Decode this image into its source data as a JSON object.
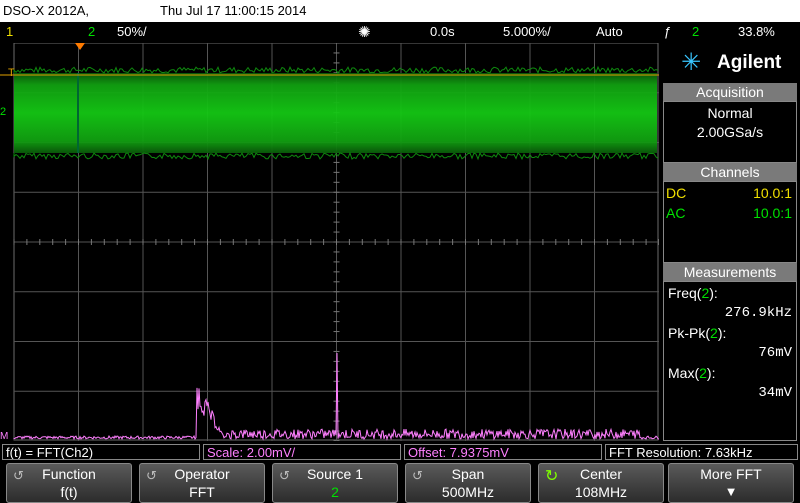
{
  "titlebar": {
    "model": "DSO-X 2012A,",
    "datetime": "Thu Jul 17 11:00:15 2014"
  },
  "statusbar": {
    "ch1_label": "1",
    "ch2_label": "2",
    "ch2_scale": "50%/",
    "trigger_pos": "0.0s",
    "timebase": "5.000%/",
    "trigger_mode": "Auto",
    "trigger_src": "2",
    "trigger_level": "33.8%",
    "colors": {
      "ch1": "#f0e000",
      "ch2": "#00e000",
      "math": "#ff80ff"
    }
  },
  "brand": {
    "name": "Agilent"
  },
  "acquisition": {
    "header": "Acquisition",
    "mode": "Normal",
    "rate": "2.00GSa/s"
  },
  "channels": {
    "header": "Channels",
    "rows": [
      {
        "coupling": "DC",
        "probe": "10.0:1"
      },
      {
        "coupling": "AC",
        "probe": "10.0:1"
      }
    ]
  },
  "measurements": {
    "header": "Measurements",
    "items": [
      {
        "name": "Freq",
        "src": "2",
        "value": "276.9kHz"
      },
      {
        "name": "Pk-Pk",
        "src": "2",
        "value": "76mV"
      },
      {
        "name": "Max",
        "src": "2",
        "value": "34mV"
      }
    ]
  },
  "grid_markers": {
    "trigger_mark": "T",
    "ch2_mark": "2",
    "math_mark": "M"
  },
  "infobar": {
    "function": "f(t) = FFT(Ch2)",
    "scale": "Scale: 2.00mV/",
    "offset": "Offset: 7.9375mV",
    "resolution": "FFT Resolution: 7.63kHz"
  },
  "softkeys": [
    {
      "label": "Function",
      "value": "f(t)"
    },
    {
      "label": "Operator",
      "value": "FFT"
    },
    {
      "label": "Source 1",
      "value": "2"
    },
    {
      "label": "Span",
      "value": "500MHz"
    },
    {
      "label": "Center",
      "value": "108MHz"
    },
    {
      "label": "More FFT",
      "value": ""
    }
  ]
}
